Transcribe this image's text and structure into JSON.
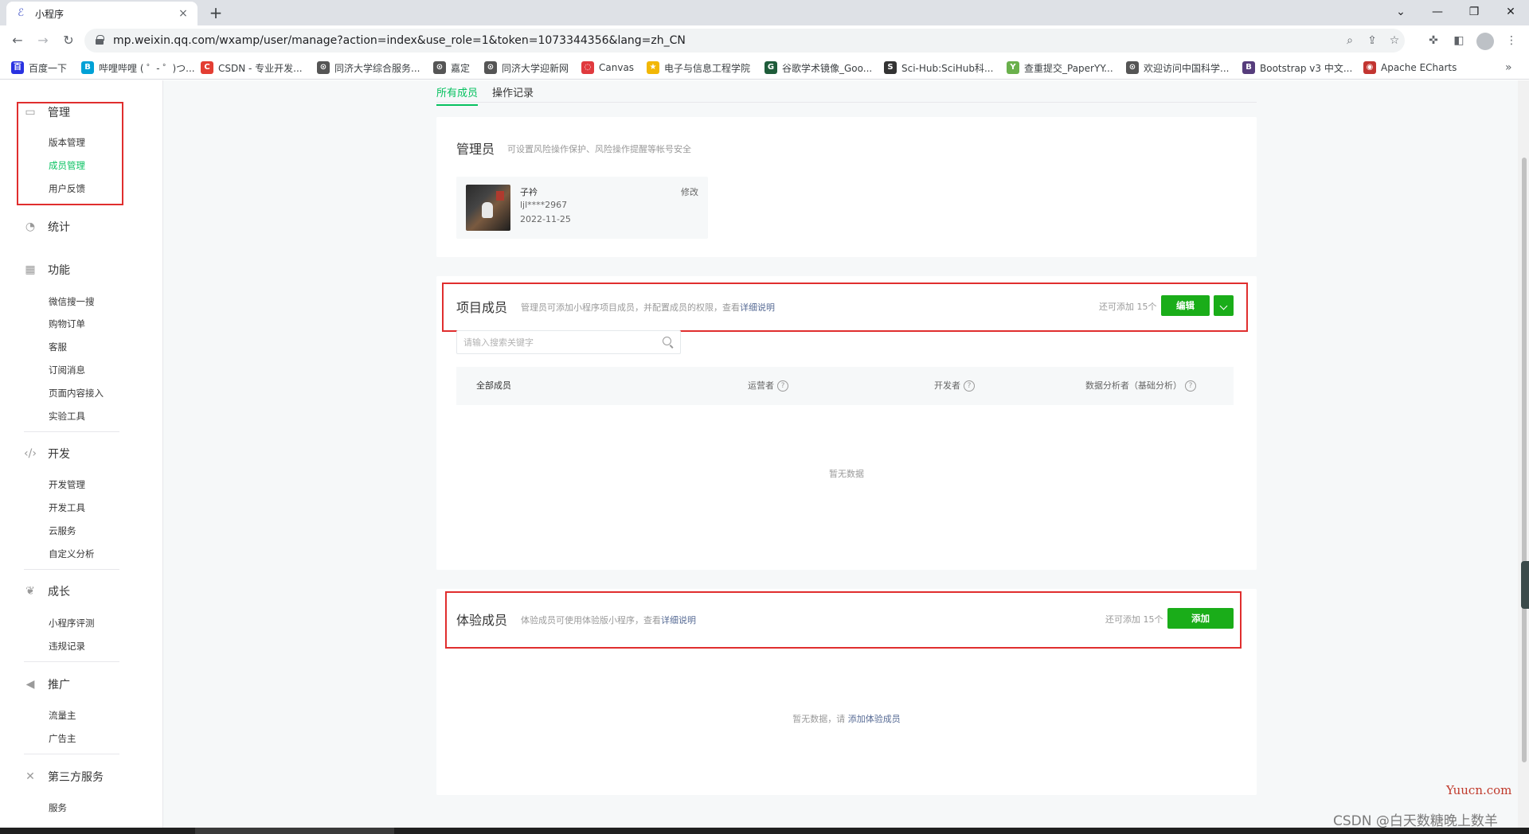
{
  "browser": {
    "tab_title": "小程序",
    "tab_close": "×",
    "new_tab": "+",
    "url": "mp.weixin.qq.com/wxamp/user/manage?action=index&use_role=1&token=1073344356&lang=zh_CN",
    "more": "»",
    "bookmarks": [
      {
        "label": "百度一下",
        "color": "#2932e1",
        "glyph": "百"
      },
      {
        "label": "哔哩哔哩 ( ゜- ゜)つ...",
        "color": "#00a1d6",
        "glyph": "B"
      },
      {
        "label": "CSDN - 专业开发...",
        "color": "#e33e33",
        "glyph": "C"
      },
      {
        "label": "同济大学综合服务...",
        "color": "#555555",
        "glyph": "⊙"
      },
      {
        "label": "嘉定",
        "color": "#555555",
        "glyph": "⊙"
      },
      {
        "label": "同济大学迎新网",
        "color": "#555555",
        "glyph": "⊙"
      },
      {
        "label": "Canvas",
        "color": "#e03a3e",
        "glyph": "◌"
      },
      {
        "label": "电子与信息工程学院",
        "color": "#f2b705",
        "glyph": "★"
      },
      {
        "label": "谷歌学术镜像_Goo...",
        "color": "#1e5c3a",
        "glyph": "G"
      },
      {
        "label": "Sci-Hub:SciHub科...",
        "color": "#333333",
        "glyph": "S"
      },
      {
        "label": "查重提交_PaperYY...",
        "color": "#6ab04c",
        "glyph": "Y"
      },
      {
        "label": "欢迎访问中国科学...",
        "color": "#555555",
        "glyph": "⊙"
      },
      {
        "label": "Bootstrap v3 中文...",
        "color": "#563d7c",
        "glyph": "B"
      },
      {
        "label": "Apache ECharts",
        "color": "#c23531",
        "glyph": "◉"
      }
    ]
  },
  "sidebar": {
    "groups": [
      {
        "title": "管理",
        "icon": "inbox-icon",
        "items": [
          "版本管理",
          "成员管理",
          "用户反馈"
        ]
      },
      {
        "title": "统计",
        "icon": "pie-chart-icon",
        "items": []
      },
      {
        "title": "功能",
        "icon": "grid-icon",
        "items": [
          "微信搜一搜",
          "购物订单",
          "客服",
          "订阅消息",
          "页面内容接入",
          "实验工具"
        ]
      },
      {
        "title": "开发",
        "icon": "code-icon",
        "items": [
          "开发管理",
          "开发工具",
          "云服务",
          "自定义分析"
        ]
      },
      {
        "title": "成长",
        "icon": "sprout-icon",
        "items": [
          "小程序评测",
          "违规记录"
        ]
      },
      {
        "title": "推广",
        "icon": "megaphone-icon",
        "items": [
          "流量主",
          "广告主"
        ]
      },
      {
        "title": "第三方服务",
        "icon": "third-party-icon",
        "items": [
          "服务"
        ]
      }
    ],
    "active_item": "成员管理"
  },
  "tabs": {
    "all_members": "所有成员",
    "operation_log": "操作记录"
  },
  "admin": {
    "title": "管理员",
    "desc": "可设置风险操作保护、风险操作提醒等帐号安全",
    "name": "子衿",
    "account": "ljl****2967",
    "date": "2022-11-25",
    "edit": "修改"
  },
  "project": {
    "title": "项目成员",
    "desc": "管理员可添加小程序项目成员，并配置成员的权限，查看",
    "desc_link": "详细说明",
    "quota": "还可添加 15个",
    "edit_btn": "编辑",
    "search_placeholder": "请输入搜索关键字",
    "columns": [
      "全部成员",
      "运营者",
      "开发者",
      "数据分析者（基础分析）"
    ],
    "empty": "暂无数据"
  },
  "experience": {
    "title": "体验成员",
    "desc": "体验成员可使用体验版小程序，查看",
    "desc_link": "详细说明",
    "quota": "还可添加 15个",
    "add_btn": "添加",
    "empty_prefix": "暂无数据，请",
    "empty_link": "添加体验成员"
  },
  "watermark": {
    "site": "Yuucn.com",
    "author": "CSDN @白天数糖晚上数羊"
  }
}
